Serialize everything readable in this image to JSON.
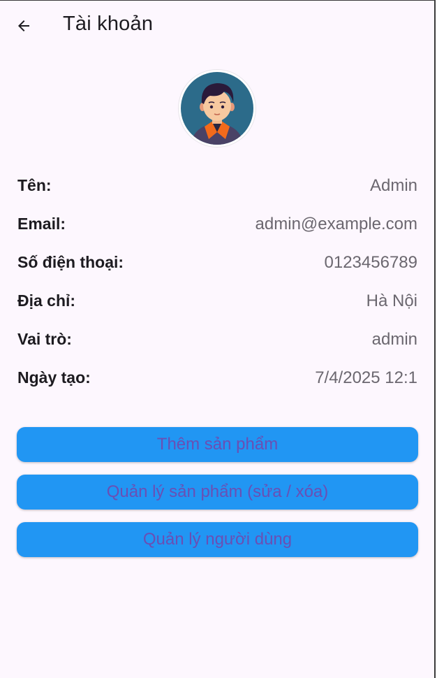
{
  "appbar": {
    "title": "Tài khoản",
    "back_icon": "arrow-left-icon"
  },
  "profile": {
    "avatar": "user-avatar-illustration",
    "fields": [
      {
        "label": "Tên:",
        "value": "Admin"
      },
      {
        "label": "Email:",
        "value": "admin@example.com"
      },
      {
        "label": "Số điện thoại:",
        "value": "0123456789"
      },
      {
        "label": "Địa chỉ:",
        "value": "Hà Nội"
      },
      {
        "label": "Vai trò:",
        "value": "admin"
      },
      {
        "label": "Ngày tạo:",
        "value": "7/4/2025 12:1"
      }
    ]
  },
  "actions": {
    "add_product": "Thêm sản phẩm",
    "manage_products": "Quản lý sản phẩm (sửa / xóa)",
    "manage_users": "Quản lý người dùng"
  },
  "colors": {
    "background": "#fdf7fe",
    "button": "#2196f3",
    "button_text": "#6a4fb4",
    "value_text": "#6b676f"
  }
}
